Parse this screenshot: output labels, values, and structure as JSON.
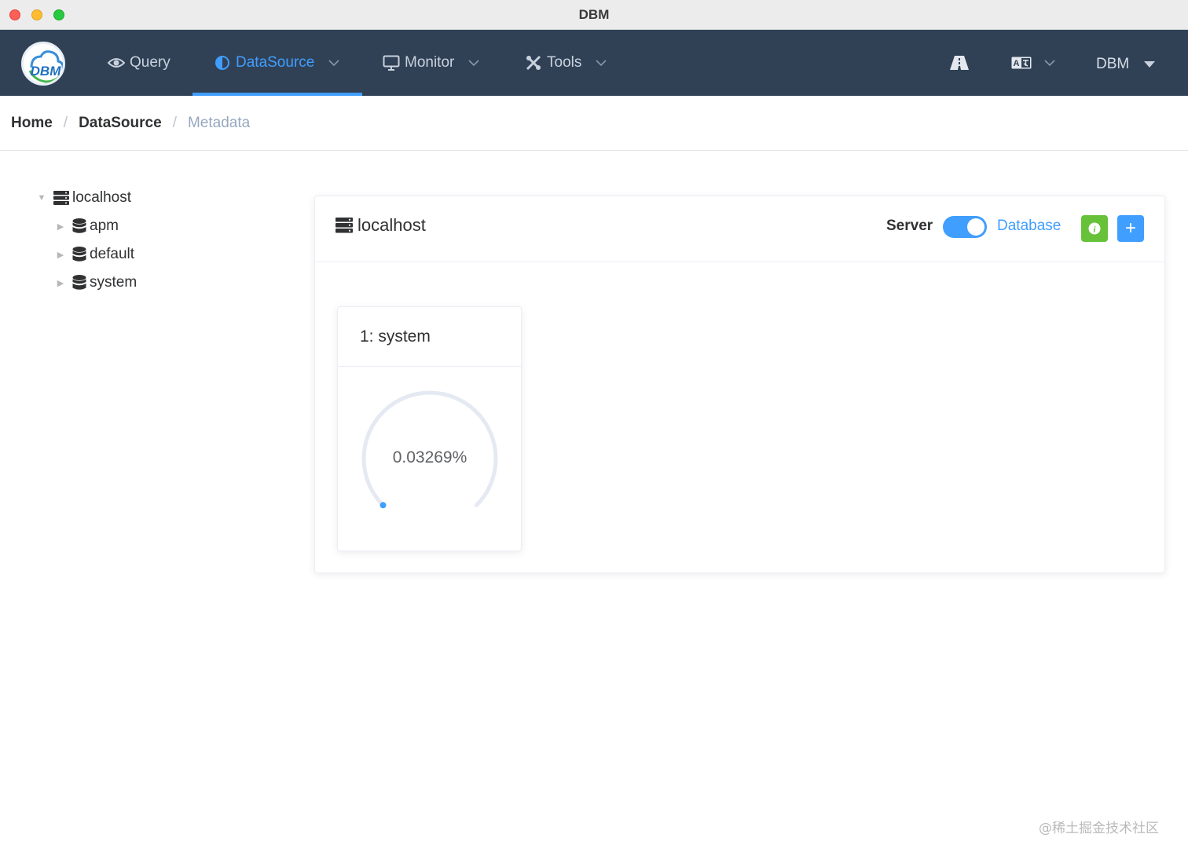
{
  "window": {
    "title": "DBM"
  },
  "navbar": {
    "logo_text": "DBM",
    "items": [
      {
        "label": "Query",
        "icon": "eye-icon"
      },
      {
        "label": "DataSource",
        "icon": "half-circle-icon",
        "active": true
      },
      {
        "label": "Monitor",
        "icon": "monitor-icon"
      },
      {
        "label": "Tools",
        "icon": "tools-icon"
      }
    ],
    "user_label": "DBM",
    "accent_color": "#409eff",
    "background_color": "#304156"
  },
  "breadcrumb": {
    "items": [
      "Home",
      "DataSource",
      "Metadata"
    ],
    "separator": "/"
  },
  "tree": {
    "root": {
      "label": "localhost",
      "icon": "server-icon",
      "expanded": true
    },
    "children": [
      {
        "label": "apm",
        "icon": "database-icon"
      },
      {
        "label": "default",
        "icon": "database-icon"
      },
      {
        "label": "system",
        "icon": "database-icon"
      }
    ]
  },
  "panel": {
    "title": "localhost",
    "switch_left_label": "Server",
    "switch_right_label": "Database",
    "switch_on": true,
    "add_button_label": "+",
    "databases": [
      {
        "title": "1: system",
        "usage_percent_label": "0.03269%",
        "usage_fraction": 0.0003269
      }
    ]
  },
  "watermark": "@稀土掘金技术社区"
}
